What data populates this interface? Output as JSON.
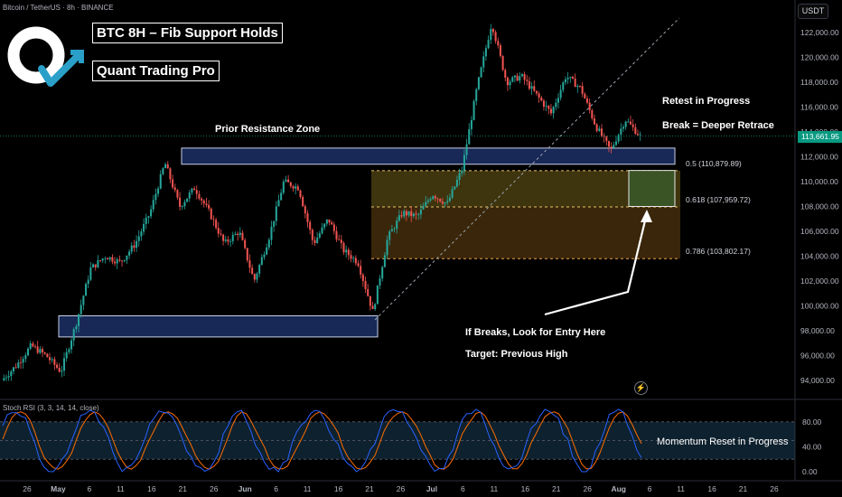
{
  "header": {
    "symbol": "Bitcoin / TetherUS · 8h · BINANCE",
    "currency": "USDT"
  },
  "overlay": {
    "title": "BTC 8H – Fib Support Holds",
    "brand": "Quant Trading Pro"
  },
  "annotations": {
    "prior_resistance": "Prior Resistance Zone",
    "retest": "Retest in Progress",
    "break_note": "Break = Deeper Retrace",
    "entry_note": "If Breaks, Look for Entry Here",
    "target_note": "Target: Previous High"
  },
  "fib_levels": [
    {
      "label": "0.5 (110,879.89)",
      "price": 110880,
      "color": "#e8c36a"
    },
    {
      "label": "0.618 (107,959.72)",
      "price": 107960,
      "color": "#e8c36a"
    },
    {
      "label": "0.786 (103,802.17)",
      "price": 103802,
      "color": "#f0a24d"
    }
  ],
  "price_axis": {
    "labels": [
      "122,000.00",
      "120,000.00",
      "118,000.00",
      "116,000.00",
      "114,000.00",
      "112,000.00",
      "110,000.00",
      "108,000.00",
      "106,000.00",
      "104,000.00",
      "102,000.00",
      "100,000.00",
      "98,000.00",
      "96,000.00",
      "94,000.00"
    ],
    "current_price": "113,661.95"
  },
  "time_axis": {
    "labels": [
      "26",
      "May",
      "6",
      "11",
      "16",
      "21",
      "26",
      "Jun",
      "6",
      "11",
      "16",
      "21",
      "26",
      "Jul",
      "6",
      "11",
      "16",
      "21",
      "26",
      "Aug",
      "6",
      "11",
      "16",
      "21",
      "26"
    ]
  },
  "indicator": {
    "label": "Stoch RSI (3, 3, 14, 14, close)",
    "note": "Momentum Reset in Progress",
    "axis_labels": [
      "80.00",
      "40.00",
      "0.00"
    ]
  },
  "colors": {
    "up": "#26a69a",
    "down": "#ef5350",
    "zone_fill": "#1c2f66",
    "fib_band": "#6b5a1e",
    "k_line": "#2962ff",
    "d_line": "#ff6d00"
  },
  "chart_data": {
    "type": "candlestick",
    "y_unit": "USDT",
    "ylim": [
      93000,
      123500
    ],
    "price_path": [
      [
        "Apr 24",
        94000
      ],
      [
        "Apr 28",
        95200
      ],
      [
        "May 1",
        96800
      ],
      [
        "May 3",
        96000
      ],
      [
        "May 6",
        94700
      ],
      [
        "May 8",
        98500
      ],
      [
        "May 10",
        103000
      ],
      [
        "May 13",
        104000
      ],
      [
        "May 16",
        103500
      ],
      [
        "May 19",
        105000
      ],
      [
        "May 21",
        107500
      ],
      [
        "May 22",
        111500
      ],
      [
        "May 25",
        108000
      ],
      [
        "May 27",
        109500
      ],
      [
        "May 29",
        107500
      ],
      [
        "Jun 1",
        105000
      ],
      [
        "Jun 3",
        106000
      ],
      [
        "Jun 5",
        102000
      ],
      [
        "Jun 7",
        105500
      ],
      [
        "Jun 9",
        110000
      ],
      [
        "Jun 11",
        109500
      ],
      [
        "Jun 13",
        105000
      ],
      [
        "Jun 16",
        107000
      ],
      [
        "Jun 18",
        104500
      ],
      [
        "Jun 20",
        103500
      ],
      [
        "Jun 22",
        99500
      ],
      [
        "Jun 24",
        105500
      ],
      [
        "Jun 26",
        107500
      ],
      [
        "Jun 30",
        107200
      ],
      [
        "Jul 3",
        109000
      ],
      [
        "Jul 6",
        108200
      ],
      [
        "Jul 9",
        111000
      ],
      [
        "Jul 11",
        117500
      ],
      [
        "Jul 14",
        122800
      ],
      [
        "Jul 16",
        118000
      ],
      [
        "Jul 19",
        118500
      ],
      [
        "Jul 22",
        117000
      ],
      [
        "Jul 25",
        115500
      ],
      [
        "Jul 28",
        118500
      ],
      [
        "Jul 30",
        117500
      ],
      [
        "Aug 1",
        114500
      ],
      [
        "Aug 2",
        112500
      ],
      [
        "Aug 4",
        115000
      ],
      [
        "Aug 5",
        113662
      ]
    ],
    "zones": [
      {
        "name": "Prior Resistance Zone",
        "low": 111400,
        "high": 112700
      },
      {
        "name": "Support Zone",
        "low": 97500,
        "high": 99200
      },
      {
        "name": "Entry Box",
        "low": 108000,
        "high": 110900
      }
    ],
    "stoch_rsi": {
      "k_range": [
        0,
        100
      ],
      "d_range": [
        0,
        100
      ],
      "bands": [
        80,
        20
      ]
    }
  }
}
